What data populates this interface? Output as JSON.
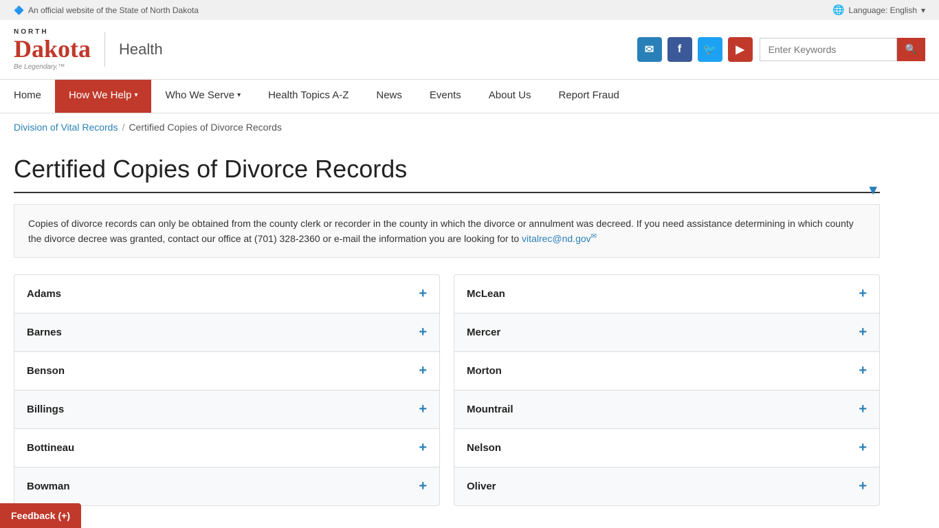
{
  "topbar": {
    "official_text": "An official website of the State of North Dakota",
    "language_label": "Language: English",
    "nd_icon": "🔷"
  },
  "header": {
    "logo_north": "NORTH",
    "logo_dakota": "Dakota",
    "logo_tagline": "Be Legendary.™",
    "logo_health": "Health",
    "search_placeholder": "Enter Keywords",
    "social": {
      "email": "✉",
      "facebook": "f",
      "twitter": "🐦",
      "youtube": "▶"
    }
  },
  "nav": {
    "items": [
      {
        "label": "Home",
        "active": false,
        "has_arrow": false
      },
      {
        "label": "How We Help",
        "active": true,
        "has_arrow": true
      },
      {
        "label": "Who We Serve",
        "active": false,
        "has_arrow": true
      },
      {
        "label": "Health Topics A-Z",
        "active": false,
        "has_arrow": false
      },
      {
        "label": "News",
        "active": false,
        "has_arrow": false
      },
      {
        "label": "Events",
        "active": false,
        "has_arrow": false
      },
      {
        "label": "About Us",
        "active": false,
        "has_arrow": false
      },
      {
        "label": "Report Fraud",
        "active": false,
        "has_arrow": false
      }
    ]
  },
  "breadcrumb": {
    "link_text": "Division of Vital Records",
    "separator": "/",
    "current": "Certified Copies of Divorce Records"
  },
  "page": {
    "title": "Certified Copies of Divorce Records",
    "intro": "Copies of divorce records can only be obtained from the county clerk or recorder in the county in which the divorce or annulment was decreed. If you need assistance determining in which county the divorce decree was granted, contact our office at (701) 328-2360 or e-mail the information you are looking for to",
    "email_link": "vitalrec@nd.gov",
    "email_suffix": "✉"
  },
  "counties_left": [
    {
      "name": "Adams"
    },
    {
      "name": "Barnes"
    },
    {
      "name": "Benson"
    },
    {
      "name": "Billings"
    },
    {
      "name": "Bottineau"
    },
    {
      "name": "Bowman"
    }
  ],
  "counties_right": [
    {
      "name": "McLean"
    },
    {
      "name": "Mercer"
    },
    {
      "name": "Morton"
    },
    {
      "name": "Mountrail"
    },
    {
      "name": "Nelson"
    },
    {
      "name": "Oliver"
    }
  ],
  "feedback": {
    "label": "Feedback (+)"
  }
}
